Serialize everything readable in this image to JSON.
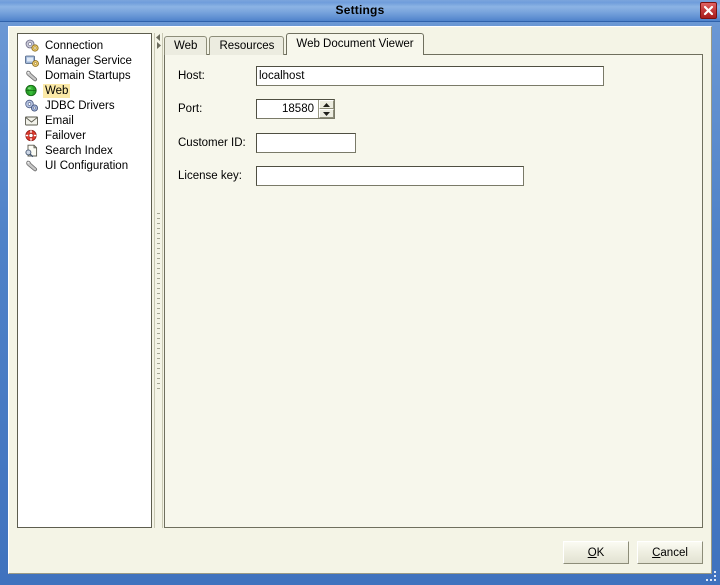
{
  "window": {
    "title": "Settings",
    "close_icon": "close-icon",
    "accent_titlebar": "#6f9ddb",
    "close_button_color": "#c33a3a",
    "panel_background": "#f4f4e6",
    "content_background": "#f7f7ec",
    "selection_highlight": "#fbe9a7"
  },
  "sidebar": {
    "items": [
      {
        "label": "Connection",
        "icon": "gears-icon",
        "selected": false
      },
      {
        "label": "Manager Service",
        "icon": "service-icon",
        "selected": false
      },
      {
        "label": "Domain Startups",
        "icon": "wrench-icon",
        "selected": false
      },
      {
        "label": "Web",
        "icon": "globe-icon",
        "selected": true
      },
      {
        "label": "JDBC Drivers",
        "icon": "gears-blue-icon",
        "selected": false
      },
      {
        "label": "Email",
        "icon": "envelope-icon",
        "selected": false
      },
      {
        "label": "Failover",
        "icon": "lifebuoy-icon",
        "selected": false
      },
      {
        "label": "Search Index",
        "icon": "document-search-icon",
        "selected": false
      },
      {
        "label": "UI Configuration",
        "icon": "wrench-icon",
        "selected": false
      }
    ]
  },
  "divider": {
    "collapse_left_icon": "triangle-left-icon",
    "collapse_right_icon": "triangle-right-icon"
  },
  "tabs": [
    {
      "label": "Web",
      "active": false
    },
    {
      "label": "Resources",
      "active": false
    },
    {
      "label": "Web Document Viewer",
      "active": true
    }
  ],
  "form": {
    "host": {
      "label": "Host:",
      "value": "localhost",
      "placeholder": ""
    },
    "port": {
      "label": "Port:",
      "value": "18580",
      "up_icon": "spinner-up-icon",
      "down_icon": "spinner-down-icon"
    },
    "customer_id": {
      "label": "Customer ID:",
      "value": "",
      "placeholder": ""
    },
    "license_key": {
      "label": "License key:",
      "value": "",
      "placeholder": ""
    }
  },
  "buttons": {
    "ok": {
      "mnemonic": "O",
      "rest": "K"
    },
    "cancel": {
      "mnemonic": "C",
      "rest": "ancel"
    }
  }
}
